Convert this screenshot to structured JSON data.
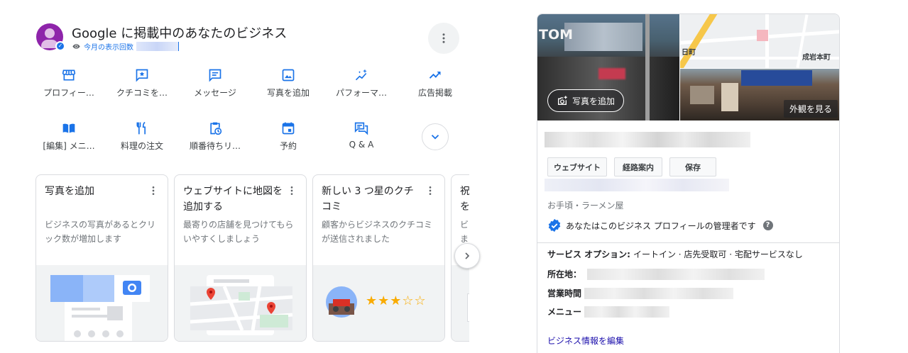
{
  "header": {
    "title": "Google に掲載中のあなたのビジネス",
    "views_label": "今月の表示回数"
  },
  "actions_row1": [
    {
      "label": "プロフィー…",
      "icon": "storefront-icon"
    },
    {
      "label": "クチコミを…",
      "icon": "review-star-icon"
    },
    {
      "label": "メッセージ",
      "icon": "message-icon"
    },
    {
      "label": "写真を追加",
      "icon": "photo-icon"
    },
    {
      "label": "パフォーマ…",
      "icon": "performance-sparkle-icon"
    },
    {
      "label": "広告掲載",
      "icon": "trending-up-icon"
    }
  ],
  "actions_row2": [
    {
      "label": "[編集] メニ…",
      "icon": "menu-book-icon"
    },
    {
      "label": "料理の注文",
      "icon": "restaurant-icon"
    },
    {
      "label": "順番待ちリ…",
      "icon": "waitlist-clipboard-icon"
    },
    {
      "label": "予約",
      "icon": "calendar-icon"
    },
    {
      "label": "Q & A",
      "icon": "qa-icon"
    }
  ],
  "cards": [
    {
      "title": "写真を追加",
      "desc": "ビジネスの写真があるとクリック数が増加します"
    },
    {
      "title": "ウェブサイトに地図を追加する",
      "desc": "最寄りの店舗を見つけてもらいやすくしましょう"
    },
    {
      "title": "新しい 3 つ星のクチコミ",
      "desc": "顧客からビジネスのクチコミが送信されました",
      "stars": "★★★☆☆"
    },
    {
      "title": "祝を",
      "desc": "ビ ま"
    }
  ],
  "profile": {
    "sign_text": "TOM",
    "add_photo": "写真を追加",
    "map_label_left": "日町",
    "map_label_right": "成岩本町",
    "exterior": "外観を見る",
    "buttons": {
      "website": "ウェブサイト",
      "directions": "経路案内",
      "save": "保存"
    },
    "category": "お手頃・ラーメン屋",
    "owner_text": "あなたはこのビジネス プロフィールの管理者です",
    "help": "?",
    "service_label": "サービス オプション:",
    "service_value": "イートイン · 店先受取可 · 宅配サービスなし",
    "address_label": "所在地：",
    "hours_label": "営業時間",
    "menu_label": "メニュー",
    "edit_link": "ビジネス情報を編集"
  },
  "colors": {
    "accent": "#1a73e8",
    "star": "#f9ab00",
    "link": "#1a0dab"
  }
}
